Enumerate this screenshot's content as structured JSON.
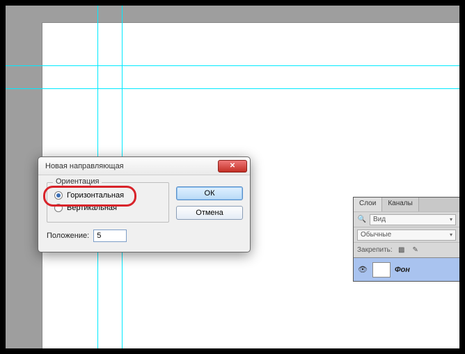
{
  "dialog": {
    "title": "Новая направляющая",
    "orientation_legend": "Ориентация",
    "horizontal_label": "Горизонтальная",
    "vertical_label": "Вертикальная",
    "position_label": "Положение:",
    "position_value": "5",
    "ok_label": "ОК",
    "cancel_label": "Отмена"
  },
  "panel": {
    "tab_layers": "Слои",
    "tab_channels": "Каналы",
    "kind_label": "Вид",
    "mode_value": "Обычные",
    "lock_label": "Закрепить:",
    "layer_name": "Фон"
  }
}
